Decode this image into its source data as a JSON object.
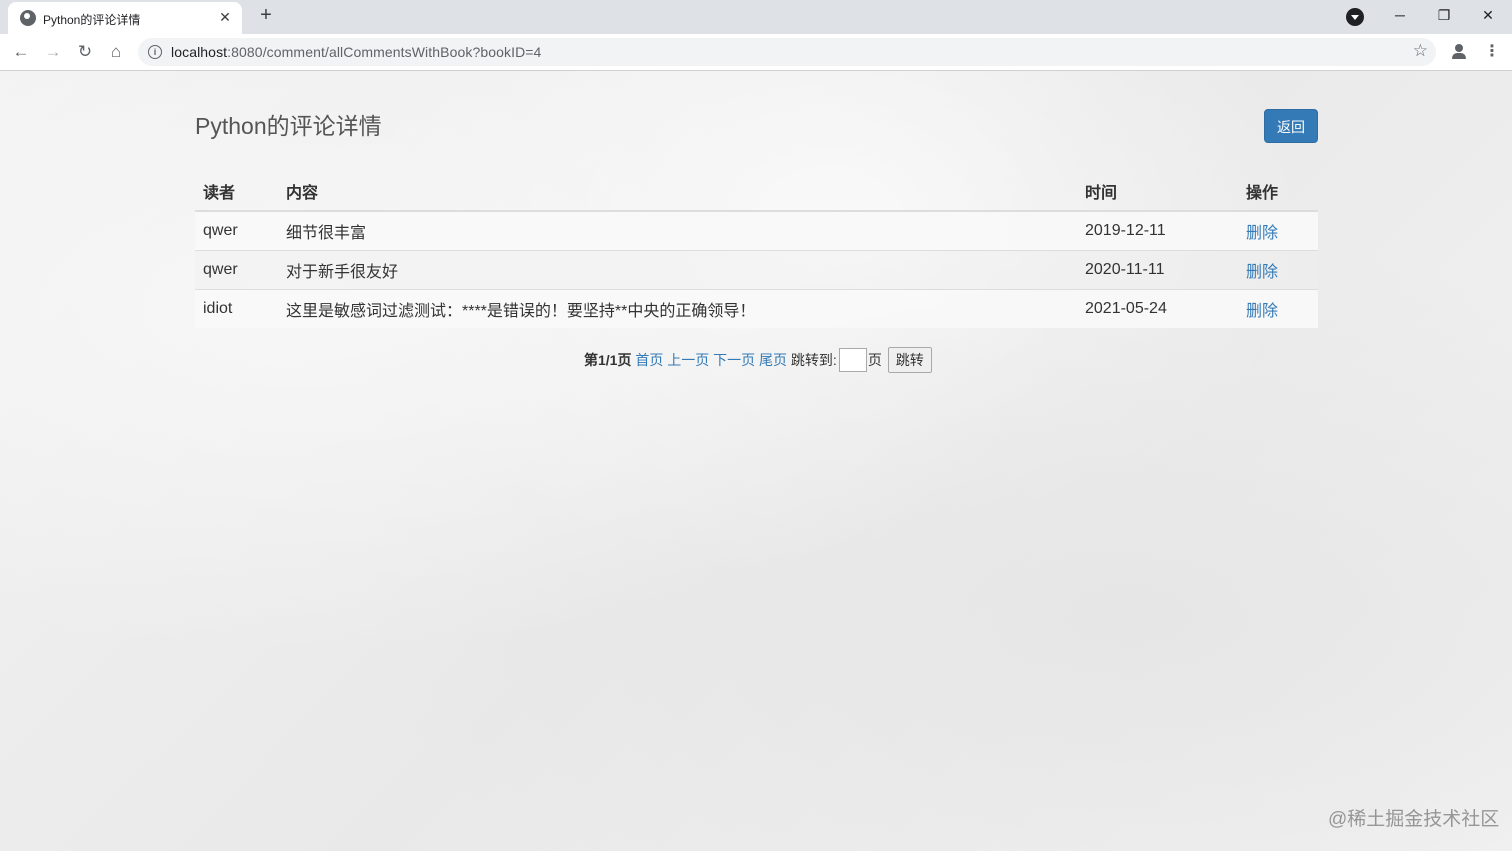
{
  "browser": {
    "tab_title": "Python的评论详情",
    "tab_close": "✕",
    "new_tab": "+",
    "url_host": "localhost",
    "url_rest": ":8080/comment/allCommentsWithBook?bookID=4",
    "nav_icons": [
      "arrow-left-icon",
      "arrow-right-icon",
      "reload-icon",
      "home-icon"
    ],
    "window_controls": {
      "minimize": "─",
      "restore": "❐",
      "close": "✕"
    }
  },
  "page": {
    "heading": "Python的评论详情",
    "back_button": "返回",
    "accent_color": "#337ab7"
  },
  "table": {
    "headers": [
      "读者",
      "内容",
      "时间",
      "操作"
    ],
    "rows": [
      {
        "reader": "qwer",
        "content": "细节很丰富",
        "time": "2019-12-11",
        "action": "删除"
      },
      {
        "reader": "qwer",
        "content": "对于新手很友好",
        "time": "2020-11-11",
        "action": "删除"
      },
      {
        "reader": "idiot",
        "content": "这里是敏感词过滤测试：****是错误的！要坚持**中央的正确领导！",
        "time": "2021-05-24",
        "action": "删除"
      }
    ]
  },
  "pager": {
    "current": "第1/1页",
    "first": "首页",
    "prev": "上一页",
    "next": "下一页",
    "last": "尾页",
    "jump_label": "跳转到:",
    "page_unit": "页",
    "jump_button": "跳转"
  },
  "watermark": {
    "text": "@稀土掘金技术社区"
  }
}
